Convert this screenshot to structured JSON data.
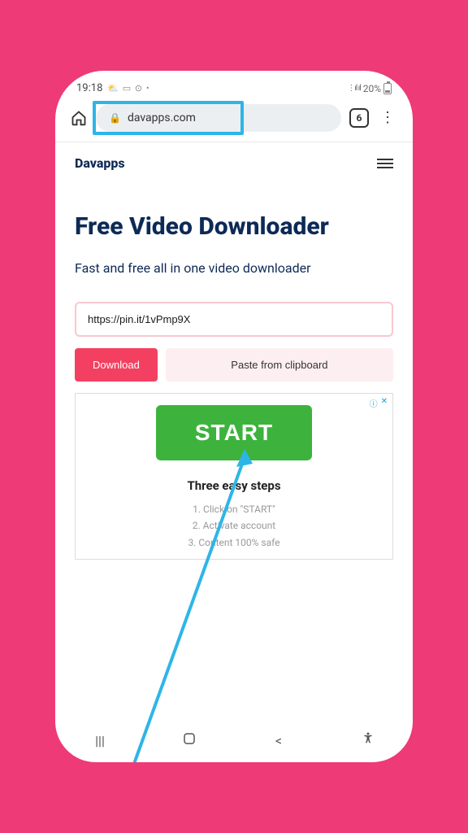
{
  "status": {
    "time": "19:18",
    "icons": "⛅ ▭ ⊙ •",
    "signal": "⋮ıl ıl",
    "battery": "20%"
  },
  "browser": {
    "url": "davapps.com",
    "tabs": "6"
  },
  "site": {
    "logo": "Davapps"
  },
  "hero": {
    "title": "Free Video Downloader",
    "subtitle": "Fast and free all in one video downloader",
    "input_value": "https://pin.it/1vPmp9X",
    "download_label": "Download",
    "paste_label": "Paste from clipboard"
  },
  "ad": {
    "info": "ⓘ",
    "close": "✕",
    "start_label": "START",
    "steps_title": "Three easy steps",
    "step1": "1. Click on \"START\"",
    "step2": "2. Activate account",
    "step3": "3. Content 100% safe"
  }
}
